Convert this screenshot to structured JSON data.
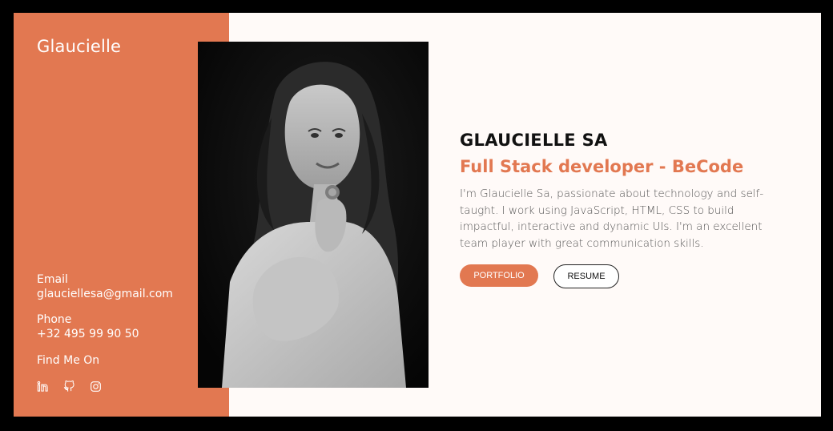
{
  "sidebar": {
    "brand": "Glaucielle",
    "email_label": "Email",
    "email_value": "glauciellesa@gmail.com",
    "phone_label": "Phone",
    "phone_value": "+32 495 99 90 50",
    "social_label": "Find Me On",
    "social_icons": [
      "linkedin-icon",
      "github-icon",
      "instagram-icon"
    ]
  },
  "main": {
    "name": "GLAUCIELLE SA",
    "role": "Full Stack developer - BeCode",
    "bio": "I'm Glaucielle Sa, passionate about technology and self-taught. I work using JavaScript, HTML, CSS to build impactful, interactive and dynamic UIs. I'm an excellent team player with great communication skills.",
    "portfolio_label": "PORTFOLIO",
    "resume_label": "RESUME"
  },
  "colors": {
    "accent": "#e27851",
    "background": "#fffaf8",
    "frame": "#000000"
  }
}
